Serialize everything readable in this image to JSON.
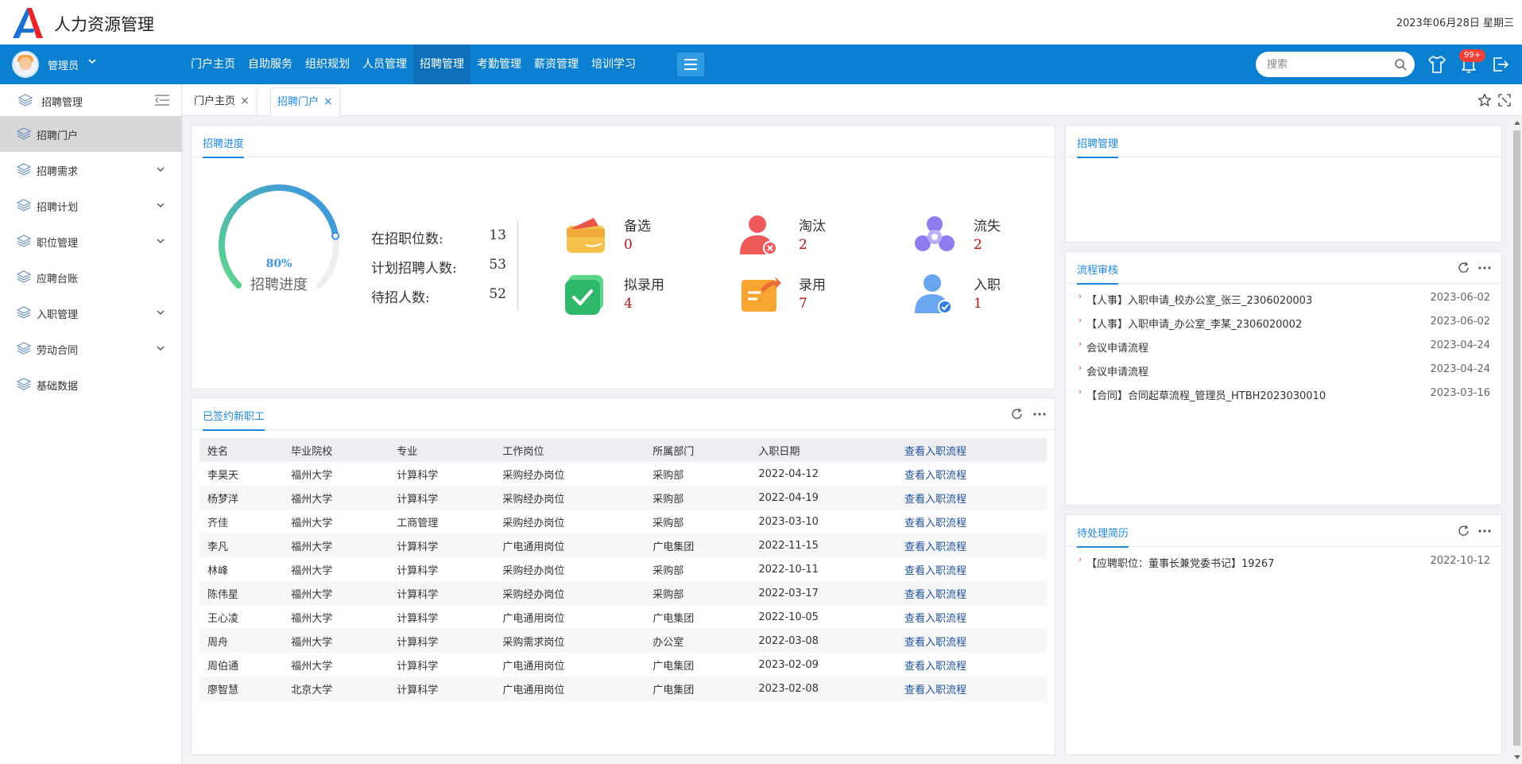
{
  "header": {
    "app_title": "人力资源管理",
    "date": "2023年06月28日  星期三"
  },
  "navbar": {
    "user_name": "管理员",
    "items": [
      "门户主页",
      "自助服务",
      "组织规划",
      "人员管理",
      "招聘管理",
      "考勤管理",
      "薪资管理",
      "培训学习"
    ],
    "active_index": 4,
    "search_placeholder": "搜索",
    "badge": "99+"
  },
  "sidebar": {
    "title": "招聘管理",
    "items": [
      {
        "label": "招聘门户",
        "expandable": false,
        "active": true
      },
      {
        "label": "招聘需求",
        "expandable": true
      },
      {
        "label": "招聘计划",
        "expandable": true
      },
      {
        "label": "职位管理",
        "expandable": true
      },
      {
        "label": "应聘台账",
        "expandable": false
      },
      {
        "label": "入职管理",
        "expandable": true
      },
      {
        "label": "劳动合同",
        "expandable": true
      },
      {
        "label": "基础数据",
        "expandable": false
      }
    ]
  },
  "tabs": [
    {
      "label": "门户主页",
      "close": "×"
    },
    {
      "label": "招聘门户",
      "close": "×"
    }
  ],
  "progress": {
    "title": "招聘进度",
    "gauge_percent": "80%",
    "gauge_value": 0.8,
    "gauge_label": "招聘进度",
    "stats": [
      {
        "label": "在招职位数:",
        "value": "13"
      },
      {
        "label": "计划招聘人数:",
        "value": "53"
      },
      {
        "label": "待招人数:",
        "value": "52"
      }
    ],
    "categories": [
      {
        "label": "备选",
        "value": "0"
      },
      {
        "label": "淘汰",
        "value": "2"
      },
      {
        "label": "流失",
        "value": "2"
      },
      {
        "label": "拟录用",
        "value": "4"
      },
      {
        "label": "录用",
        "value": "7"
      },
      {
        "label": "入职",
        "value": "1"
      }
    ]
  },
  "employees": {
    "title": "已签约新职工",
    "columns": [
      "姓名",
      "毕业院校",
      "专业",
      "工作岗位",
      "所属部门",
      "入职日期",
      "查看入职流程"
    ],
    "rows": [
      [
        "李昊天",
        "福州大学",
        "计算科学",
        "采购经办岗位",
        "采购部",
        "2022-04-12",
        "查看入职流程"
      ],
      [
        "杨梦洋",
        "福州大学",
        "计算科学",
        "采购经办岗位",
        "采购部",
        "2022-04-19",
        "查看入职流程"
      ],
      [
        "齐佳",
        "福州大学",
        "工商管理",
        "采购经办岗位",
        "采购部",
        "2023-03-10",
        "查看入职流程"
      ],
      [
        "李凡",
        "福州大学",
        "计算科学",
        "广电通用岗位",
        "广电集团",
        "2022-11-15",
        "查看入职流程"
      ],
      [
        "林峰",
        "福州大学",
        "计算科学",
        "采购经办岗位",
        "采购部",
        "2022-10-11",
        "查看入职流程"
      ],
      [
        "陈伟星",
        "福州大学",
        "计算科学",
        "采购经办岗位",
        "采购部",
        "2022-03-17",
        "查看入职流程"
      ],
      [
        "王心凌",
        "福州大学",
        "计算科学",
        "广电通用岗位",
        "广电集团",
        "2022-10-05",
        "查看入职流程"
      ],
      [
        "周舟",
        "福州大学",
        "计算科学",
        "采购需求岗位",
        "办公室",
        "2022-03-08",
        "查看入职流程"
      ],
      [
        "周伯通",
        "福州大学",
        "计算科学",
        "广电通用岗位",
        "广电集团",
        "2023-02-09",
        "查看入职流程"
      ],
      [
        "廖智慧",
        "北京大学",
        "计算科学",
        "广电通用岗位",
        "广电集团",
        "2023-02-08",
        "查看入职流程"
      ]
    ]
  },
  "recruit_mgmt": {
    "title": "招聘管理"
  },
  "workflow": {
    "title": "流程审核",
    "items": [
      {
        "text": "【人事】入职申请_校办公室_张三_2306020003",
        "date": "2023-06-02"
      },
      {
        "text": "【人事】入职申请_办公室_李某_2306020002",
        "date": "2023-06-02"
      },
      {
        "text": "会议申请流程",
        "date": "2023-04-24"
      },
      {
        "text": "会议申请流程",
        "date": "2023-04-24"
      },
      {
        "text": "【合同】合同起草流程_管理员_HTBH2023030010",
        "date": "2023-03-16"
      }
    ]
  },
  "resumes": {
    "title": "待处理简历",
    "items": [
      {
        "text": "【应聘职位：董事长兼党委书记】19267",
        "date": "2022-10-12"
      }
    ]
  },
  "colors": {
    "primary": "#0b7fd0",
    "accent": "#1e88e5",
    "badge": "#f0403c",
    "value_red": "#b51212"
  }
}
